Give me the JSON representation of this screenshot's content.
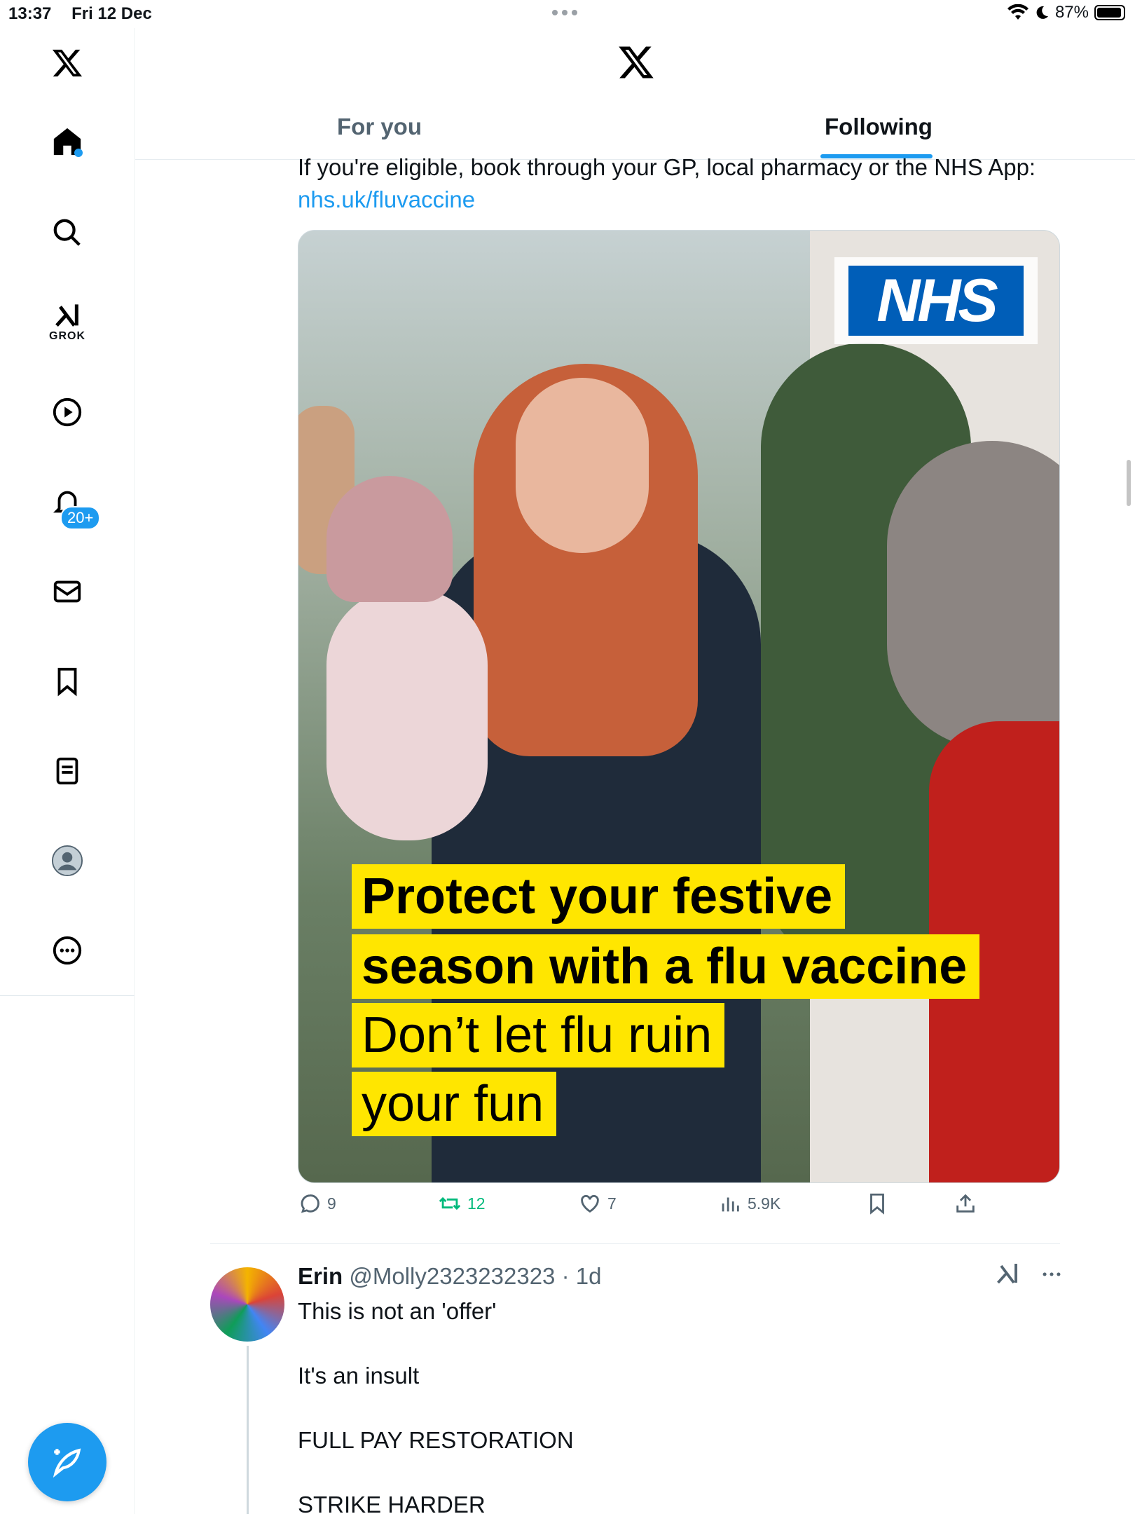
{
  "status_bar": {
    "time": "13:37",
    "date": "Fri 12 Dec",
    "battery": "87%"
  },
  "sidebar": {
    "items": [
      {
        "icon": "x-logo-icon"
      },
      {
        "icon": "home-icon"
      },
      {
        "icon": "search-icon"
      },
      {
        "icon": "grok-icon",
        "label": "GROK"
      },
      {
        "icon": "play-icon"
      },
      {
        "icon": "bell-icon",
        "badge": "20+"
      },
      {
        "icon": "mail-icon"
      },
      {
        "icon": "bookmark-icon"
      },
      {
        "icon": "list-icon"
      },
      {
        "icon": "profile-icon"
      },
      {
        "icon": "more-icon"
      }
    ],
    "compose_icon": "compose-icon"
  },
  "header": {
    "tabs": [
      {
        "label": "For you"
      },
      {
        "label": "Following",
        "active": true
      }
    ]
  },
  "tweet": {
    "text": "If you're eligible, book through your GP, local pharmacy or the NHS App:",
    "link": "nhs.uk/fluvaccine",
    "media": {
      "logo": "NHS",
      "caption": [
        "Protect your festive",
        "season with a flu vaccine",
        "Don’t let flu ruin",
        "your fun"
      ]
    },
    "stats": {
      "replies": "9",
      "retweets": "12",
      "likes": "7",
      "views": "5.9K"
    }
  },
  "reply": {
    "name": "Erin",
    "handle": "@Molly2323232323",
    "time": "· 1d",
    "text": "This is not an 'offer'\n\nIt's an insult\n\nFULL PAY RESTORATION\n\nSTRIKE HARDER"
  },
  "colors": {
    "accent": "#1d9bf0",
    "nhs_blue": "#005eb8",
    "caption_yellow": "#ffe600",
    "retweet_green": "#00ba7c"
  }
}
